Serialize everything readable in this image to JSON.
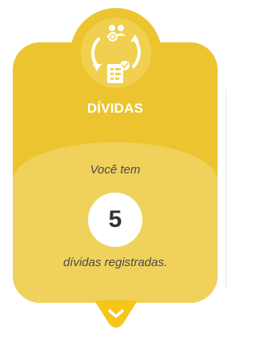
{
  "card": {
    "title": "DÍVIDAS",
    "intro_text": "Você tem",
    "count": "5",
    "outro_text": "dívidas registradas."
  },
  "icons": {
    "badge_icon": "debt-cycle-icon",
    "expand_icon": "chevron-down-icon"
  },
  "colors": {
    "card_primary": "#ecc42f",
    "card_secondary": "#f0d15b",
    "badge_inner": "#f1cf4f",
    "title_text": "#ffffff",
    "body_text": "#4a4a4a",
    "expand_tab": "#f5c518"
  }
}
